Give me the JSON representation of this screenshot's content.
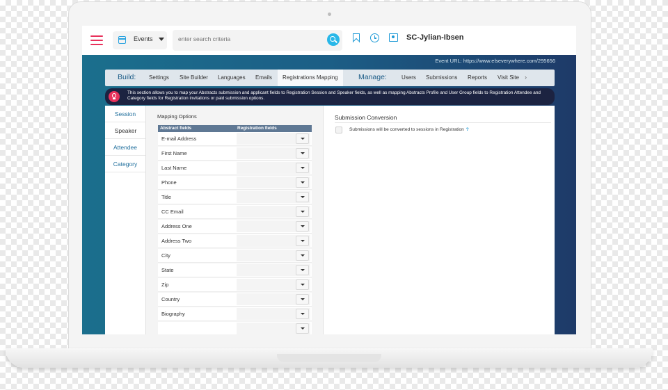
{
  "header": {
    "module_label": "Events",
    "search_placeholder": "enter search criteria",
    "site_title": "SC-Jylian-Ibsen"
  },
  "event_url": "Event URL: https://www.elseverywhere.com/295656",
  "nav": {
    "build_label": "Build:",
    "build_items": [
      "Settings",
      "Site Builder",
      "Languages",
      "Emails",
      "Registrations Mapping"
    ],
    "manage_label": "Manage:",
    "manage_items": [
      "Users",
      "Submissions",
      "Reports",
      "Visit Site"
    ],
    "more_glyph": "›"
  },
  "notice": "This section allows you to map your Abstracts submission and applicant fields to Registration Session and Speaker fields, as well as mapping Abstracts Profile and User Group fields to Registration Attendee and Category fields for Registration invitations or paid submission options.",
  "subtabs": [
    "Session",
    "Speaker",
    "Attendee",
    "Category"
  ],
  "mapping": {
    "title": "Mapping Options",
    "col_abstract": "Abstract fields",
    "col_registration": "Registration fields",
    "rows": [
      "E-mail Address",
      "First Name",
      "Last Name",
      "Phone",
      "Title",
      "CC Email",
      "Address One",
      "Address Two",
      "City",
      "State",
      "Zip",
      "Country",
      "Biography",
      ""
    ]
  },
  "conversion": {
    "title": "Submission Conversion",
    "label": "Submissions will be converted to sessions in Registration",
    "help": "?"
  }
}
